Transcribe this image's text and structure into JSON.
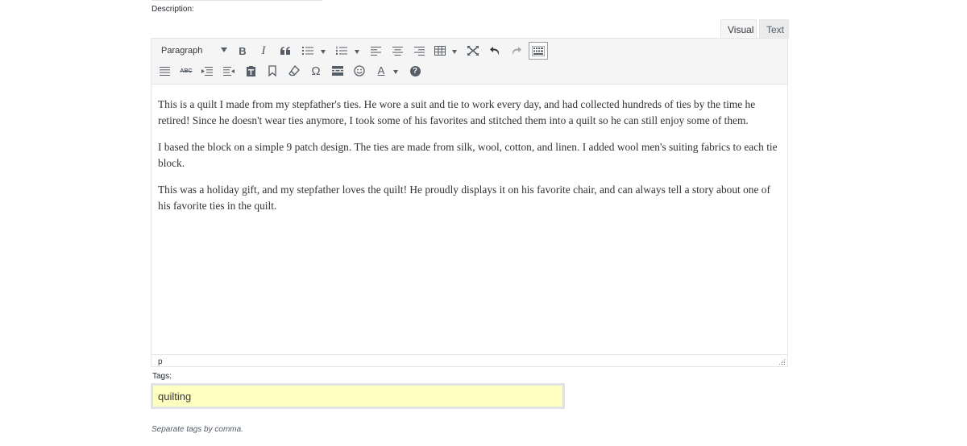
{
  "description_label": "Description:",
  "tabs": {
    "visual": "Visual",
    "text": "Text"
  },
  "toolbar": {
    "format_select_value": "Paragraph",
    "row1_icons": [
      "bold-icon",
      "italic-icon",
      "blockquote-icon",
      "bullet-list-icon",
      "numbered-list-icon",
      "align-left-icon",
      "align-center-icon",
      "align-right-icon",
      "table-icon",
      "fullscreen-icon",
      "undo-icon",
      "redo-icon",
      "toolbar-toggle-icon"
    ],
    "row2_icons": [
      "horizontal-rule-icon",
      "strikethrough-icon",
      "outdent-icon",
      "indent-icon",
      "paste-text-icon",
      "bookmark-icon",
      "clear-formatting-icon",
      "special-character-icon",
      "read-more-icon",
      "emoticons-icon",
      "text-color-icon",
      "help-icon"
    ],
    "bold_glyph": "B",
    "italic_glyph": "I",
    "strike_glyph": "ABC",
    "omega_glyph": "Ω",
    "textcolor_glyph": "A",
    "help_glyph": "?"
  },
  "content": {
    "paragraphs": [
      "This is a quilt I made from my stepfather's ties. He wore a suit and tie to work every day, and had collected hundreds of ties by the time he retired! Since he doesn't wear ties anymore, I took some of his favorites and stitched them into a quilt so he can still enjoy some of them.",
      "I based the block on a simple 9 patch design. The ties are made from silk, wool, cotton, and linen. I added wool men's suiting fabrics to each tie block.",
      "This was a holiday gift, and my stepfather loves the quilt! He proudly displays it on his favorite chair, and can always tell a story about one of his favorite ties in the quilt."
    ]
  },
  "statusbar": {
    "path": "p"
  },
  "tags": {
    "label": "Tags:",
    "value": "quilting",
    "hint": "Separate tags by comma."
  },
  "colors": {
    "toolbar_bg": "#f5f5f5",
    "tags_input_bg": "#ffffc0",
    "border": "#e5e5e5"
  }
}
